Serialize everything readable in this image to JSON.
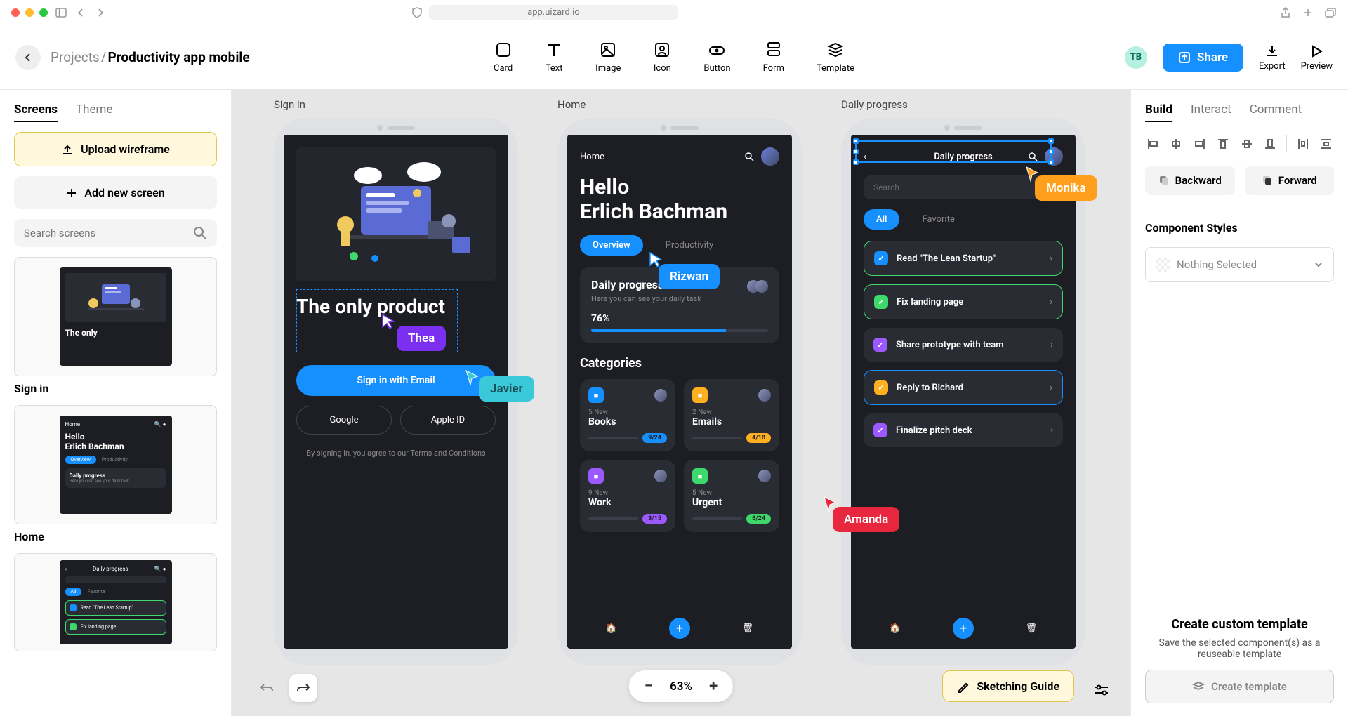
{
  "chrome": {
    "url": "app.uizard.io"
  },
  "breadcrumb": {
    "root": "Projects",
    "sep": "/",
    "current": "Productivity app mobile"
  },
  "tools": [
    {
      "label": "Card"
    },
    {
      "label": "Text"
    },
    {
      "label": "Image"
    },
    {
      "label": "Icon"
    },
    {
      "label": "Button"
    },
    {
      "label": "Form"
    },
    {
      "label": "Template"
    }
  ],
  "user_badge": "TB",
  "share_label": "Share",
  "export_label": "Export",
  "preview_label": "Preview",
  "left": {
    "tabs": {
      "screens": "Screens",
      "theme": "Theme"
    },
    "upload": "Upload wireframe",
    "add": "Add new screen",
    "search_placeholder": "Search screens",
    "thumbs": [
      {
        "label": "Sign in"
      },
      {
        "label": "Home"
      }
    ]
  },
  "right": {
    "tabs": {
      "build": "Build",
      "interact": "Interact",
      "comment": "Comment"
    },
    "backward": "Backward",
    "forward": "Forward",
    "styles_title": "Component Styles",
    "nothing": "Nothing Selected",
    "template_title": "Create custom template",
    "template_sub": "Save the selected component(s) as a reuseable template",
    "template_btn": "Create template"
  },
  "canvas": {
    "zoom": "63%",
    "sketch": "Sketching Guide",
    "screens": {
      "signin": {
        "label": "Sign in",
        "heading": "The only product",
        "email_btn": "Sign in with Email",
        "google": "Google",
        "apple": "Apple ID",
        "terms": "By signing in, you agree to our Terms and Conditions"
      },
      "home": {
        "label": "Home",
        "crumb": "Home",
        "hello": "Hello",
        "name": "Erlich Bachman",
        "tabs": {
          "overview": "Overview",
          "productivity": "Productivity"
        },
        "progress": {
          "title": "Daily progress",
          "sub": "Here you can see your daily task",
          "pct": "76%",
          "pct_num": 76
        },
        "cat_title": "Categories",
        "cats": [
          {
            "new": "5 New",
            "name": "Books",
            "badge": "9/24",
            "color": "#168fff",
            "badge_bg": "#168fff"
          },
          {
            "new": "2 New",
            "name": "Emails",
            "badge": "4/18",
            "color": "#ffb020",
            "badge_bg": "#ffb020"
          },
          {
            "new": "9 New",
            "name": "Work",
            "badge": "3/15",
            "color": "#9b59ff",
            "badge_bg": "#9b59ff"
          },
          {
            "new": "5 New",
            "name": "Urgent",
            "badge": "8/24",
            "color": "#3dd96a",
            "badge_bg": "#3dd96a"
          }
        ]
      },
      "daily": {
        "label": "Daily progress",
        "title": "Daily progress",
        "search": "Search",
        "filters": {
          "all": "All",
          "fav": "Favorite"
        },
        "tasks": [
          {
            "text": "Read \"The Lean Startup\"",
            "color": "#168fff",
            "border": "#3dd96a"
          },
          {
            "text": "Fix landing page",
            "color": "#3dd96a",
            "border": "#3dd96a"
          },
          {
            "text": "Share prototype with team",
            "color": "#9b59ff",
            "border": "transparent"
          },
          {
            "text": "Reply to Richard",
            "color": "#ffb020",
            "border": "#168fff"
          },
          {
            "text": "Finalize pitch deck",
            "color": "#9b59ff",
            "border": "transparent"
          }
        ]
      }
    },
    "cursors": {
      "thea": "Thea",
      "javier": "Javier",
      "rizwan": "Rizwan",
      "monika": "Monika",
      "amanda": "Amanda"
    }
  },
  "thumb_signin": {
    "heading": "The only"
  },
  "thumb_home": {
    "crumb": "Home",
    "hello": "Hello",
    "name": "Erlich Bachman",
    "overview": "Overview",
    "productivity": "Productivity",
    "dp_title": "Daily progress",
    "dp_sub": "Here you can see your daily task"
  },
  "thumb_daily": {
    "title": "Daily progress",
    "all": "All",
    "fav": "Favorite",
    "t1": "Read \"The Lean Startup\"",
    "t2": "Fix landing page"
  }
}
